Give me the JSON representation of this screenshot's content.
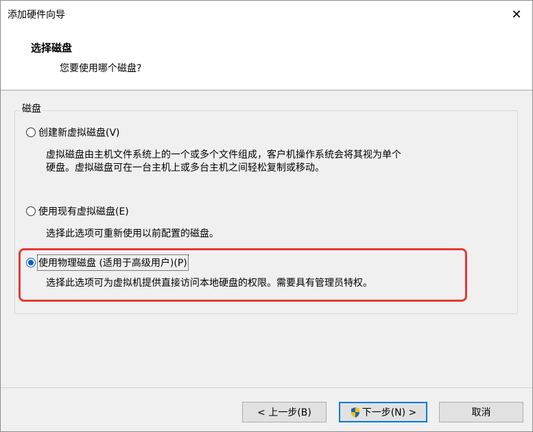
{
  "window": {
    "title": "添加硬件向导",
    "close_glyph": "✕"
  },
  "header": {
    "title": "选择磁盘",
    "subtitle": "您要使用哪个磁盘?"
  },
  "group": {
    "label": "磁盘"
  },
  "options": [
    {
      "label": "创建新虚拟磁盘(V)",
      "checked": false,
      "description_lines": [
        "虚拟磁盘由主机文件系统上的一个或多个文件组成，客户机操作系统会将其视为单个",
        "硬盘。虚拟磁盘可在一台主机上或多台主机之间轻松复制或移动。"
      ]
    },
    {
      "label": "使用现有虚拟磁盘(E)",
      "checked": false,
      "description_lines": [
        "选择此选项可重新使用以前配置的磁盘。"
      ]
    },
    {
      "label": "使用物理磁盘 (适用于高级用户)(P)",
      "checked": true,
      "description_lines": [
        "选择此选项可为虚拟机提供直接访问本地硬盘的权限。需要具有管理员特权。"
      ]
    }
  ],
  "buttons": {
    "back": "< 上一步(B)",
    "next": "下一步(N) >",
    "cancel": "取消"
  },
  "colors": {
    "accent": "#0078d7",
    "highlight": "#e53935"
  },
  "icons": {
    "next": "uac-shield-icon",
    "close": "close-icon"
  }
}
